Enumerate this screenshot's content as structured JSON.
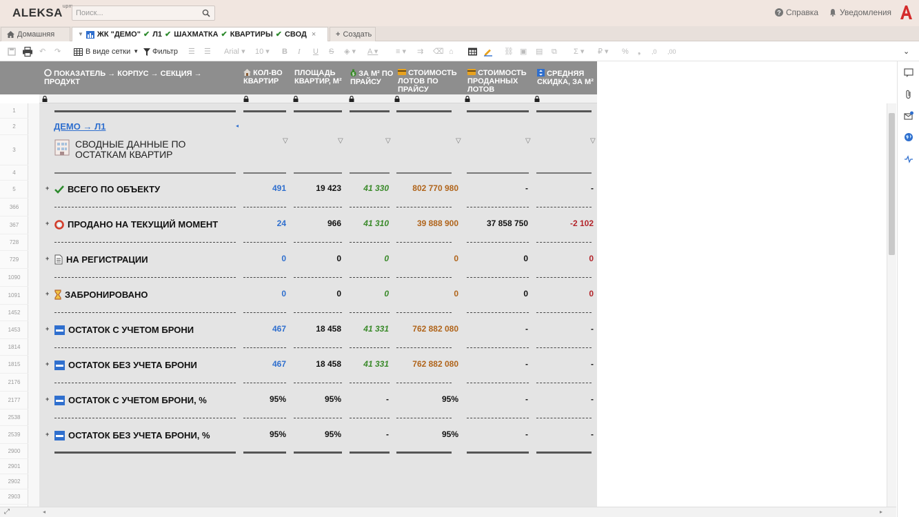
{
  "app": {
    "logo": "ALEKSA",
    "logo_sup": "upm"
  },
  "search": {
    "placeholder": "Поиск..."
  },
  "top_links": {
    "help": "Справка",
    "notifications": "Уведомления"
  },
  "tabs": {
    "home": "Домашняя",
    "active_parts": [
      "ЖК \"ДЕМО\"",
      "Л1",
      "ШАХМАТКА",
      "КВАРТИРЫ",
      "СВОД"
    ],
    "create": "Создать"
  },
  "toolbar": {
    "grid_view": "В виде сетки",
    "filter": "Фильтр",
    "font": "Arial",
    "font_size": "10",
    "bold": "B",
    "italic": "I",
    "underline": "U",
    "strike": "S",
    "sum": "Σ",
    "currency": "₽",
    "percent": "%",
    "decimal_minus": ",0",
    "decimal_plus": ",00"
  },
  "columns": [
    {
      "label": "Показатель → Корпус → Секция → Продукт",
      "icon": "circle-icon"
    },
    {
      "label": "Кол-во квартир",
      "icon": "house-icon"
    },
    {
      "label": "Площадь квартир, м²",
      "icon": ""
    },
    {
      "label": "за м² по прайсу",
      "icon": "money-bag-icon"
    },
    {
      "label": "Стоимость лотов по прайсу",
      "icon": "wallet-icon"
    },
    {
      "label": "Стоимость проданных лотов",
      "icon": "wallet-icon"
    },
    {
      "label": "Средняя скидка, за м²",
      "icon": "arrows-icon"
    }
  ],
  "breadcrumb": "ДЕМО → Л1",
  "title": "СВОДНЫЕ ДАННЫЕ ПО ОСТАТКАМ КВАРТИР",
  "row_numbers": [
    "1",
    "2",
    "3",
    "4",
    "5",
    "366",
    "367",
    "728",
    "729",
    "1090",
    "1091",
    "1452",
    "1453",
    "1814",
    "1815",
    "2176",
    "2177",
    "2538",
    "2539",
    "2900",
    "2901",
    "2902",
    "2903"
  ],
  "rows": [
    {
      "label": "ВСЕГО ПО ОБЪЕКТУ",
      "icon": "check-icon",
      "values": [
        "491",
        "19 423",
        "41 330",
        "802 770 980",
        "-",
        "-"
      ]
    },
    {
      "label": "ПРОДАНО НА ТЕКУЩИЙ МОМЕНТ",
      "icon": "lifebuoy-icon",
      "values": [
        "24",
        "966",
        "41 310",
        "39 888 900",
        "37 858 750",
        "-2 102"
      ]
    },
    {
      "label": "НА РЕГИСТРАЦИИ",
      "icon": "document-icon",
      "values": [
        "0",
        "0",
        "0",
        "0",
        "0",
        "0"
      ]
    },
    {
      "label": "ЗАБРОНИРОВАНО",
      "icon": "hourglass-icon",
      "values": [
        "0",
        "0",
        "0",
        "0",
        "0",
        "0"
      ]
    },
    {
      "label": "ОСТАТОК С УЧЕТОМ БРОНИ",
      "icon": "new-badge-icon",
      "values": [
        "467",
        "18 458",
        "41 331",
        "762 882 080",
        "-",
        "-"
      ]
    },
    {
      "label": "ОСТАТОК БЕЗ УЧЕТА БРОНИ",
      "icon": "new-badge-icon",
      "values": [
        "467",
        "18 458",
        "41 331",
        "762 882 080",
        "-",
        "-"
      ]
    },
    {
      "label": "ОСТАТОК С УЧЕТОМ БРОНИ, %",
      "icon": "new-badge-icon",
      "values": [
        "95%",
        "95%",
        "-",
        "95%",
        "-",
        "-"
      ]
    },
    {
      "label": "ОСТАТОК БЕЗ УЧЕТА БРОНИ, %",
      "icon": "new-badge-icon",
      "values": [
        "95%",
        "95%",
        "-",
        "95%",
        "-",
        "-"
      ]
    }
  ],
  "colors": {
    "blue": "#2f6fce",
    "green": "#3a8a2a",
    "brown": "#b0641a",
    "red": "#b3242a",
    "header": "#8e8e8e",
    "brand": "#d42b2b"
  }
}
